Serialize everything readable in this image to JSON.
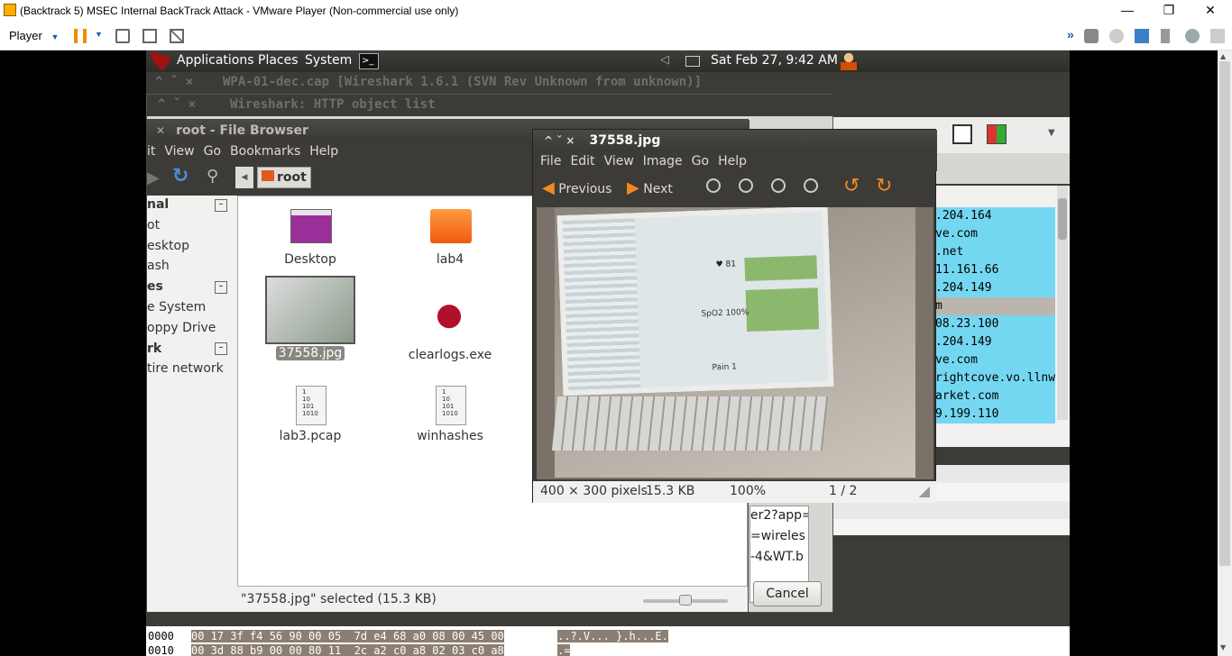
{
  "vmware": {
    "title": "(Backtrack 5) MSEC Internal BackTrack Attack - VMware Player (Non-commercial use only)",
    "player_menu": "Player",
    "accent_color": "#1e5bb4"
  },
  "panel": {
    "applications": "Applications",
    "places": "Places",
    "system": "System",
    "clock": "Sat Feb 27,  9:42 AM"
  },
  "wireshark": {
    "title": "WPA-01-dec.cap   [Wireshark 1.6.1  (SVN Rev Unknown from unknown)]",
    "http_objects_title": "Wireshark: HTTP object list",
    "hosts": [
      ".204.164",
      "ve.com",
      ".net",
      "11.161.66",
      ".204.149",
      "m",
      "08.23.100",
      ".204.149",
      "ve.com",
      "rightcove.vo.llnw",
      "arket.com",
      "9.199.110"
    ],
    "urls": [
      "er2?app=",
      "=wireles",
      "-4&WT.b"
    ],
    "cancel_label": "Cancel",
    "hex_rows": [
      {
        "offset": "0000",
        "hex": "00 17 3f f4 56 90 00 05  7d e4 68 a0 08 00 45 00",
        "ascii": "..?.V... }.h...E."
      },
      {
        "offset": "0010",
        "hex": "00 3d 88 b9 00 00 80 11  2c a2 c0 a8 02 03 c0 a8",
        "ascii": ".="
      }
    ]
  },
  "file_browser": {
    "title": "root - File Browser",
    "menu": [
      "it",
      "View",
      "Go",
      "Bookmarks",
      "Help"
    ],
    "location": "root",
    "sidebar": [
      {
        "label": "nal",
        "header": true
      },
      {
        "label": "ot",
        "header": false
      },
      {
        "label": "esktop",
        "header": false
      },
      {
        "label": "ash",
        "header": false
      },
      {
        "label": "es",
        "header": true
      },
      {
        "label": "e System",
        "header": false
      },
      {
        "label": "oppy Drive",
        "header": false
      },
      {
        "label": "rk",
        "header": true
      },
      {
        "label": "tire network",
        "header": false
      }
    ],
    "files": [
      {
        "name": "Desktop",
        "icon": "desktop-folder-icon"
      },
      {
        "name": "lab4",
        "icon": "folder-icon"
      },
      {
        "name": "37558.jpg",
        "icon": "image-thumbnail",
        "selected": true
      },
      {
        "name": "clearlogs.exe",
        "icon": "wine-icon"
      },
      {
        "name": "lab3.pcap",
        "icon": "binary-file-icon"
      },
      {
        "name": "winhashes",
        "icon": "binary-file-icon"
      }
    ],
    "status": "\"37558.jpg\" selected (15.3 KB)"
  },
  "image_viewer": {
    "title": "37558.jpg",
    "menu": [
      "File",
      "Edit",
      "View",
      "Image",
      "Go",
      "Help"
    ],
    "previous_label": "Previous",
    "next_label": "Next",
    "status": {
      "dimensions": "400 × 300 pixels",
      "size": "15.3 KB",
      "zoom": "100%",
      "position": "1 / 2"
    },
    "photo_labels": {
      "heart": "♥ 81",
      "spo2": "SpO2 100%",
      "pain": "Pain 1"
    }
  }
}
